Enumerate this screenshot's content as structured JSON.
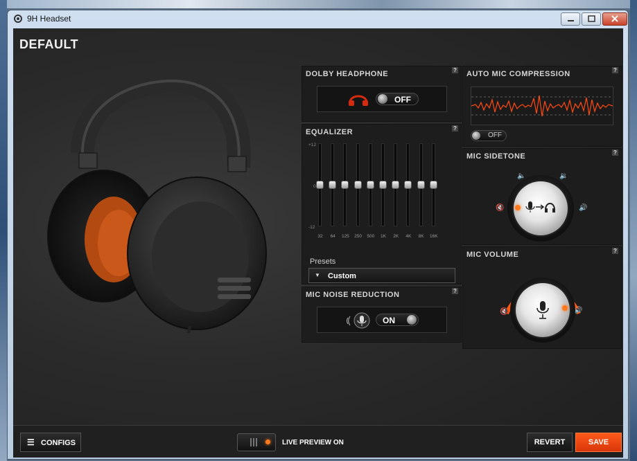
{
  "window": {
    "title": "9H Headset"
  },
  "page": {
    "title": "DEFAULT"
  },
  "panels": {
    "dolby": {
      "title": "DOLBY HEADPHONE",
      "toggle_label": "OFF",
      "help": "?"
    },
    "equalizer": {
      "title": "EQUALIZER",
      "help": "?",
      "scale": [
        "+12",
        "0",
        "-12"
      ],
      "bands": [
        {
          "label": "32",
          "value": 0
        },
        {
          "label": "64",
          "value": 0
        },
        {
          "label": "125",
          "value": 0
        },
        {
          "label": "250",
          "value": 0
        },
        {
          "label": "500",
          "value": 0
        },
        {
          "label": "1K",
          "value": 0
        },
        {
          "label": "2K",
          "value": 0
        },
        {
          "label": "4K",
          "value": 0
        },
        {
          "label": "8K",
          "value": 0
        },
        {
          "label": "16K",
          "value": 0
        }
      ],
      "presets_label": "Presets",
      "preset_value": "Custom"
    },
    "noise_reduction": {
      "title": "MIC NOISE REDUCTION",
      "toggle_label": "ON",
      "help": "?"
    },
    "auto_mic": {
      "title": "AUTO MIC COMPRESSION",
      "toggle_label": "OFF",
      "help": "?"
    },
    "sidetone": {
      "title": "MIC SIDETONE",
      "help": "?"
    },
    "mic_volume": {
      "title": "MIC VOLUME",
      "help": "?"
    }
  },
  "bottom": {
    "configs_label": "CONFIGS",
    "live_preview_label": "LIVE PREVIEW ON",
    "revert_label": "REVERT",
    "save_label": "SAVE"
  },
  "colors": {
    "accent": "#ff5a1a",
    "background": "#2a2a2a"
  }
}
